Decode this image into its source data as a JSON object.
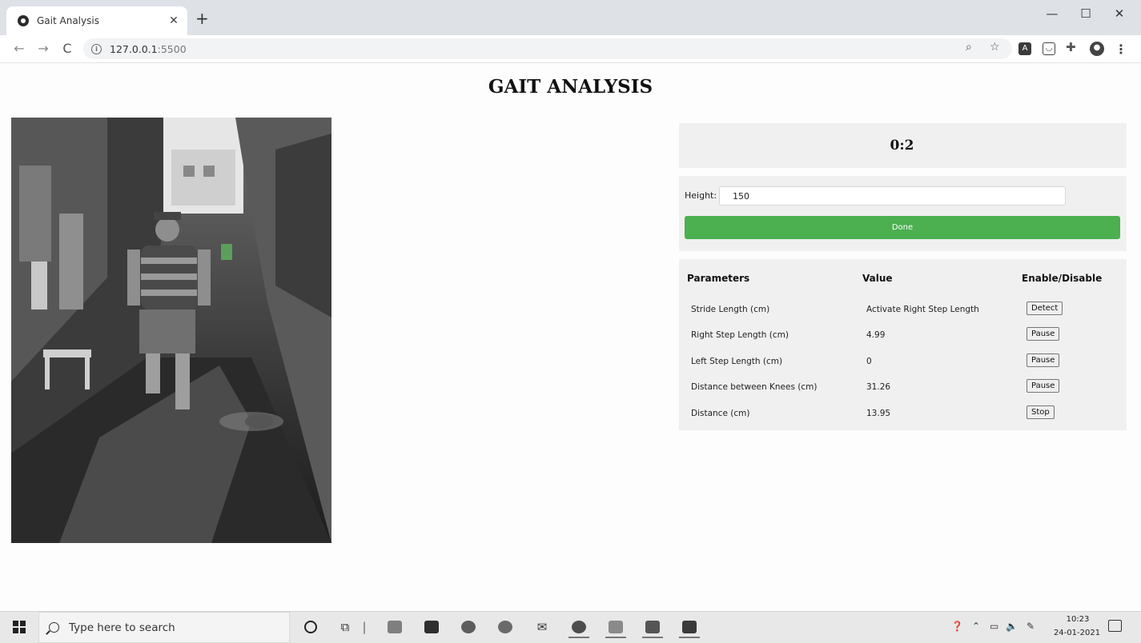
{
  "browser": {
    "tab_title": "Gait Analysis",
    "tab_close": "✕",
    "new_tab": "+",
    "url_host": "127.0.0.1",
    "url_port": ":5500",
    "window_controls": {
      "minimize": "—",
      "maximize": "☐",
      "close": "✕"
    },
    "nav": {
      "back": "←",
      "forward": "→",
      "reload": "C"
    },
    "icons": [
      "zoom-icon",
      "star-icon",
      "pdf-extension-icon",
      "pocket-extension-icon",
      "extensions-puzzle-icon",
      "profile-icon",
      "menu-icon"
    ]
  },
  "page": {
    "title": "GAIT ANALYSIS",
    "timer": "0:2",
    "height_label": "Height:",
    "height_value": "150",
    "done_label": "Done",
    "params": {
      "header_param": "Parameters",
      "header_value": "Value",
      "header_toggle": "Enable/Disable",
      "rows": [
        {
          "name": "Stride Length (cm)",
          "value": "Activate Right Step Length",
          "button": "Detect"
        },
        {
          "name": "Right Step Length (cm)",
          "value": "4.99",
          "button": "Pause"
        },
        {
          "name": "Left Step Length (cm)",
          "value": "0",
          "button": "Pause"
        },
        {
          "name": "Distance between Knees (cm)",
          "value": "31.26",
          "button": "Pause"
        },
        {
          "name": "Distance (cm)",
          "value": "13.95",
          "button": "Stop"
        }
      ]
    },
    "colors": {
      "done_button": "#4caf50",
      "panel_bg": "#f0f0f0"
    }
  },
  "taskbar": {
    "search_placeholder": "Type here to search",
    "time": "10:23",
    "date": "24-01-2021",
    "pinned_icons": [
      "cortana-icon",
      "task-view-icon",
      "file-explorer-icon",
      "store-icon",
      "powerpoint-icon",
      "edge-icon",
      "mail-icon",
      "chrome-icon",
      "image-viewer-icon",
      "word-icon",
      "vscode-icon"
    ]
  }
}
